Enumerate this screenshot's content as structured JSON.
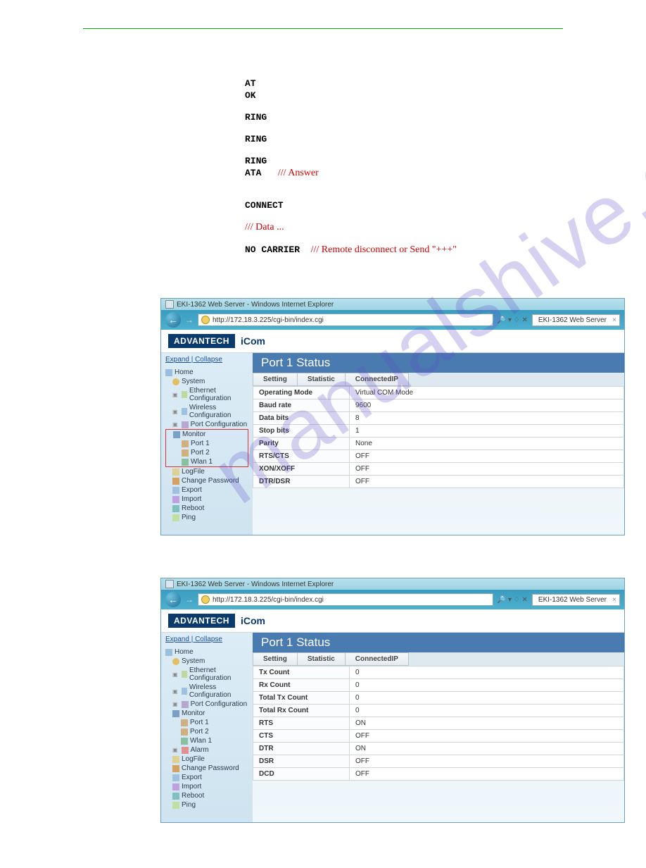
{
  "terminal": {
    "l1": "AT",
    "l2": "OK",
    "l3": "RING",
    "l4": "RING",
    "l5": "RING",
    "l6": "ATA",
    "l6note": "/// Answer",
    "l7": "CONNECT",
    "l8note": "/// Data ...",
    "l9": "NO CARRIER",
    "l9note": "/// Remote disconnect or Send \"+++\""
  },
  "watermark": "manualshive.com",
  "browser": {
    "title": "EKI-1362 Web Server - Windows Internet Explorer",
    "url": "http://172.18.3.225/cgi-bin/index.cgi",
    "searchGlyph": "🔎 ▾ ♢ ✕",
    "tabTitle": "EKI-1362 Web Server",
    "tabClose": "×",
    "back": "←",
    "fwd": "→"
  },
  "logo": {
    "adv": "ADVANTECH",
    "icom": "iCom"
  },
  "sidebar": {
    "expand": "Expand",
    "sep": " | ",
    "collapse": "Collapse",
    "home": "Home",
    "system": "System",
    "ethernet": "Ethernet Configuration",
    "wireless": "Wireless Configuration",
    "portconf": "Port Configuration",
    "monitor": "Monitor",
    "port1": "Port 1",
    "port2": "Port 2",
    "wlan1": "Wlan 1",
    "alarm": "Alarm",
    "logfile": "LogFile",
    "chpass": "Change Password",
    "export": "Export",
    "import": "Import",
    "reboot": "Reboot",
    "ping": "Ping"
  },
  "panel1": {
    "title": "Port 1 Status",
    "tabs": {
      "setting": "Setting",
      "statistic": "Statistic",
      "connip": "ConnectedIP"
    },
    "rows": [
      {
        "k": "Operating Mode",
        "v": "Virtual COM Mode"
      },
      {
        "k": "Baud rate",
        "v": "9600"
      },
      {
        "k": "Data bits",
        "v": "8"
      },
      {
        "k": "Stop bits",
        "v": "1"
      },
      {
        "k": "Parity",
        "v": "None"
      },
      {
        "k": "RTS/CTS",
        "v": "OFF"
      },
      {
        "k": "XON/XOFF",
        "v": "OFF"
      },
      {
        "k": "DTR/DSR",
        "v": "OFF"
      }
    ]
  },
  "panel2": {
    "title": "Port 1 Status",
    "tabs": {
      "setting": "Setting",
      "statistic": "Statistic",
      "connip": "ConnectedIP"
    },
    "rows": [
      {
        "k": "Tx Count",
        "v": "0"
      },
      {
        "k": "Rx Count",
        "v": "0"
      },
      {
        "k": "Total Tx Count",
        "v": "0"
      },
      {
        "k": "Total Rx Count",
        "v": "0"
      },
      {
        "k": "RTS",
        "v": "ON"
      },
      {
        "k": "CTS",
        "v": "OFF"
      },
      {
        "k": "DTR",
        "v": "ON"
      },
      {
        "k": "DSR",
        "v": "OFF"
      },
      {
        "k": "DCD",
        "v": "OFF"
      }
    ]
  }
}
